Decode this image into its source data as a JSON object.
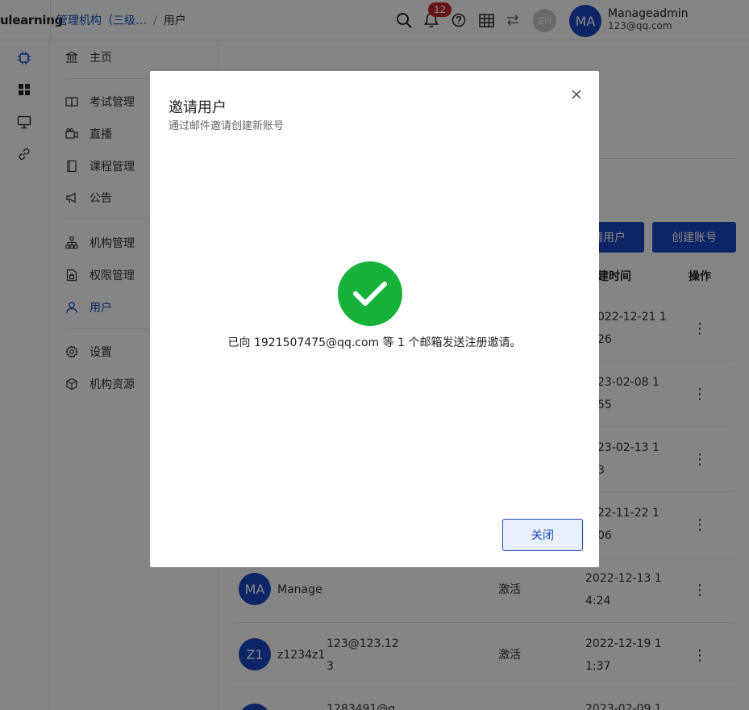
{
  "brand": "ulearning",
  "breadcrumb": {
    "org": "管理机构（三级…",
    "separator": "/",
    "current": "用户"
  },
  "topbar": {
    "notification_count": "12",
    "switch_avatar": "ZH",
    "user": {
      "initials": "MA",
      "name": "Manageadmin",
      "email": "123@qq.com"
    }
  },
  "rail_icons": [
    "chip-icon",
    "grid-icon",
    "monitor-icon",
    "link-icon"
  ],
  "sidebar": {
    "items": [
      {
        "label": "主页",
        "icon": "bank-icon"
      },
      {
        "label": "考试管理",
        "icon": "book-icon"
      },
      {
        "label": "直播",
        "icon": "video-icon"
      },
      {
        "label": "课程管理",
        "icon": "course-icon"
      },
      {
        "label": "公告",
        "icon": "megaphone-icon"
      },
      {
        "label": "机构管理",
        "icon": "org-chart-icon"
      },
      {
        "label": "权限管理",
        "icon": "permission-icon"
      },
      {
        "label": "用户",
        "icon": "user-icon",
        "active": true
      },
      {
        "label": "设置",
        "icon": "gear-icon"
      },
      {
        "label": "机构资源",
        "icon": "cube-icon"
      }
    ]
  },
  "main": {
    "buttons": {
      "invite_partial": "请用户",
      "create": "创建账号"
    },
    "table": {
      "headers": {
        "created_partial": "建时间",
        "actions": "操作"
      },
      "rows": [
        {
          "time_line1": "022-12-21 1",
          "time_line2": "26"
        },
        {
          "time_line1": "23-02-08 1",
          "time_line2": "55"
        },
        {
          "time_line1": "23-02-13 1",
          "time_line2": "3"
        },
        {
          "time_line1": "22-11-22 1",
          "time_line2": "06"
        },
        {
          "avatar": "MA",
          "name": "Manage",
          "email_line1": "",
          "email_line2": "",
          "status": "激活",
          "time_line1": "2022-12-13 1",
          "time_line2": "4:24"
        },
        {
          "avatar": "Z1",
          "name": "z1234z1",
          "email_line1": "123@123.12",
          "email_line2": "3",
          "status": "激活",
          "time_line1": "2022-12-19 1",
          "time_line2": "1:37"
        },
        {
          "avatar": "",
          "name": "",
          "email_line1": "1283491@q",
          "email_line2": "",
          "status": "",
          "time_line1": "2023-02-09 1",
          "time_line2": ""
        }
      ]
    }
  },
  "modal": {
    "title": "邀请用户",
    "subtitle": "通过邮件邀请创建新账号",
    "message": "已向 1921507475@qq.com 等 1 个邮箱发送注册邀请。",
    "close_button": "关闭",
    "success_color": "#16b23a"
  },
  "colors": {
    "primary": "#1c47c2",
    "badge": "#c8252b"
  }
}
